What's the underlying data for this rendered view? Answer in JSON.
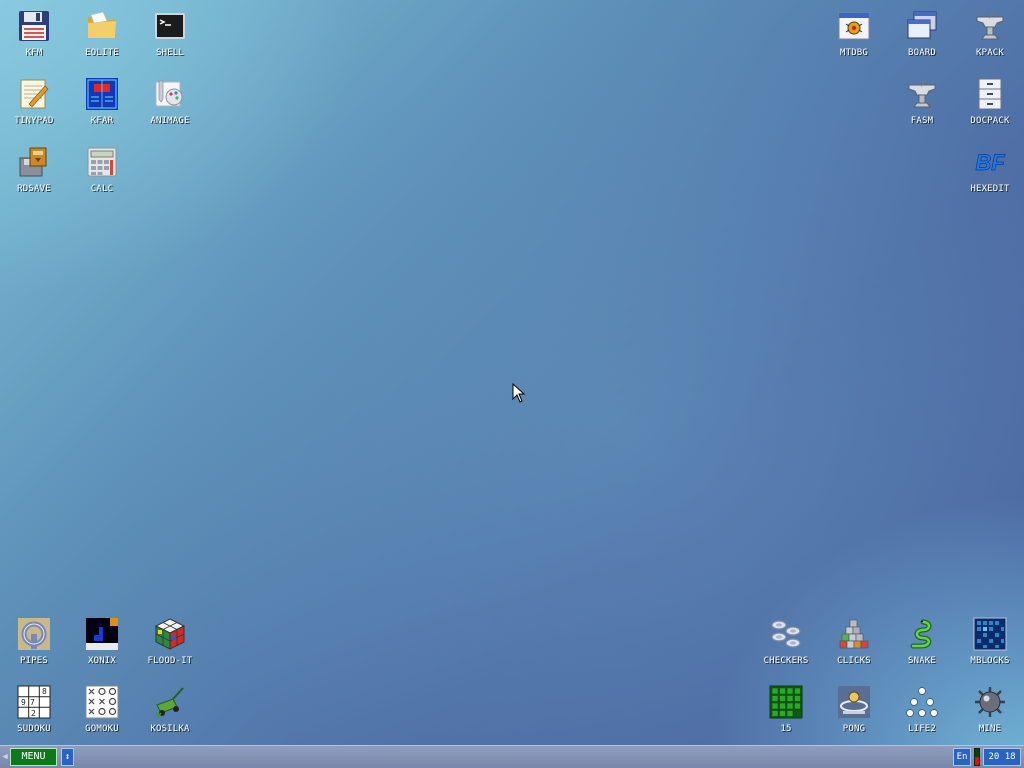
{
  "desktop": {
    "icons_top_left": [
      {
        "label": "KFM",
        "icon": "floppy-disk-icon"
      },
      {
        "label": "EOLITE",
        "icon": "folder-icon"
      },
      {
        "label": "SHELL",
        "icon": "terminal-icon"
      },
      {
        "label": "TINYPAD",
        "icon": "notepad-icon"
      },
      {
        "label": "KFAR",
        "icon": "file-manager-icon"
      },
      {
        "label": "ANIMAGE",
        "icon": "paint-icon"
      },
      {
        "label": "RDSAVE",
        "icon": "save-disk-icon"
      },
      {
        "label": "CALC",
        "icon": "calculator-icon"
      }
    ],
    "icons_top_right": [
      {
        "label": "MTDBG",
        "icon": "debugger-icon"
      },
      {
        "label": "BOARD",
        "icon": "windows-icon"
      },
      {
        "label": "KPACK",
        "icon": "anvil-icon"
      },
      {
        "label": "FASM",
        "icon": "anvil-icon"
      },
      {
        "label": "DOCPACK",
        "icon": "cabinet-icon"
      },
      {
        "label": "HEXEDIT",
        "icon": "hexedit-icon",
        "glyph_text": "BF"
      }
    ],
    "icons_bottom_left": [
      {
        "label": "PIPES",
        "icon": "pipes-icon"
      },
      {
        "label": "XONIX",
        "icon": "xonix-icon"
      },
      {
        "label": "FLOOD-IT",
        "icon": "rubiks-cube-icon"
      },
      {
        "label": "SUDOKU",
        "icon": "sudoku-icon"
      },
      {
        "label": "GOMOKU",
        "icon": "gomoku-icon"
      },
      {
        "label": "KOSILKA",
        "icon": "lawnmower-icon"
      }
    ],
    "icons_bottom_right": [
      {
        "label": "CHECKERS",
        "icon": "checkers-icon"
      },
      {
        "label": "CLICKS",
        "icon": "blocks-icon"
      },
      {
        "label": "SNAKE",
        "icon": "snake-icon"
      },
      {
        "label": "MBLOCKS",
        "icon": "grid-game-icon"
      },
      {
        "label": "15",
        "icon": "fifteen-puzzle-icon"
      },
      {
        "label": "PONG",
        "icon": "pong-icon"
      },
      {
        "label": "LIFE2",
        "icon": "life-dots-icon"
      },
      {
        "label": "MINE",
        "icon": "mine-icon"
      }
    ],
    "colors": {
      "bg_light": "#7cc0d6",
      "bg_dark": "#4a64a0",
      "label_text": "#ffffff"
    }
  },
  "taskbar": {
    "menu_label": "MENU",
    "switch_label": "↕",
    "lang_label": "En",
    "clock_text": "20 18",
    "colors": {
      "menu_bg": "#0c7a1a",
      "button_bg": "#2a64c0",
      "bar_bg": "#7f8fb2"
    }
  }
}
